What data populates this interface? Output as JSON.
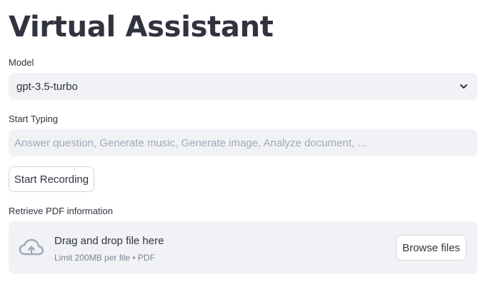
{
  "header": {
    "title": "Virtual Assistant"
  },
  "model": {
    "label": "Model",
    "selected": "gpt-3.5-turbo"
  },
  "prompt": {
    "label": "Start Typing",
    "value": "",
    "placeholder": "Answer question, Generate music, Generate image, Analyze document, ..."
  },
  "recording": {
    "button_label": "Start Recording"
  },
  "pdf": {
    "label": "Retrieve PDF information",
    "dropzone_text": "Drag and drop file here",
    "limit_text": "Limit 200MB per file • PDF",
    "browse_label": "Browse files"
  },
  "icons": {
    "select_chevron": "chevron-down-icon",
    "upload": "cloud-upload-icon"
  },
  "colors": {
    "text": "#31333f",
    "input_bg": "#f0f2f6",
    "muted_text": "#808495",
    "placeholder": "#a3a8b8",
    "border": "#d6d6d9"
  }
}
